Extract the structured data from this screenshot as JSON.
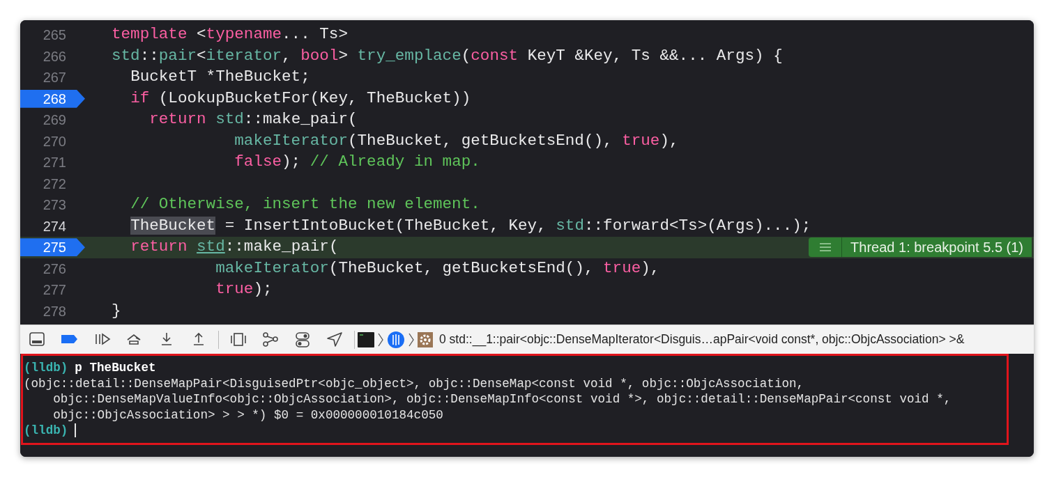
{
  "editor": {
    "lines": [
      {
        "number": "265",
        "breakpoint": false,
        "current": false,
        "focused": false,
        "tokens": [
          {
            "kind": "keyword",
            "text": "template"
          },
          {
            "kind": "plain",
            "text": " <"
          },
          {
            "kind": "keyword",
            "text": "typename"
          },
          {
            "kind": "plain",
            "text": "... Ts>"
          }
        ]
      },
      {
        "number": "266",
        "breakpoint": false,
        "current": false,
        "focused": false,
        "tokens": [
          {
            "kind": "type",
            "text": "std"
          },
          {
            "kind": "plain",
            "text": "::"
          },
          {
            "kind": "type",
            "text": "pair"
          },
          {
            "kind": "plain",
            "text": "<"
          },
          {
            "kind": "type",
            "text": "iterator"
          },
          {
            "kind": "plain",
            "text": ", "
          },
          {
            "kind": "keyword",
            "text": "bool"
          },
          {
            "kind": "plain",
            "text": "> "
          },
          {
            "kind": "type",
            "text": "try_emplace"
          },
          {
            "kind": "plain",
            "text": "("
          },
          {
            "kind": "keyword",
            "text": "const"
          },
          {
            "kind": "plain",
            "text": " KeyT &Key, Ts &&... Args) {"
          }
        ]
      },
      {
        "number": "267",
        "breakpoint": false,
        "current": false,
        "focused": false,
        "tokens": [
          {
            "kind": "plain",
            "text": "  BucketT *TheBucket;"
          }
        ]
      },
      {
        "number": "268",
        "breakpoint": true,
        "current": false,
        "focused": false,
        "tokens": [
          {
            "kind": "keyword",
            "text": "  if"
          },
          {
            "kind": "plain",
            "text": " (LookupBucketFor(Key, TheBucket))"
          }
        ]
      },
      {
        "number": "269",
        "breakpoint": false,
        "current": false,
        "focused": false,
        "tokens": [
          {
            "kind": "keyword",
            "text": "    return "
          },
          {
            "kind": "type",
            "text": "std"
          },
          {
            "kind": "plain",
            "text": "::make_pair("
          }
        ]
      },
      {
        "number": "270",
        "breakpoint": false,
        "current": false,
        "focused": false,
        "tokens": [
          {
            "kind": "type",
            "text": "             makeIterator"
          },
          {
            "kind": "plain",
            "text": "(TheBucket, getBucketsEnd(), "
          },
          {
            "kind": "keyword",
            "text": "true"
          },
          {
            "kind": "plain",
            "text": "),"
          }
        ]
      },
      {
        "number": "271",
        "breakpoint": false,
        "current": false,
        "focused": false,
        "tokens": [
          {
            "kind": "keyword",
            "text": "             false"
          },
          {
            "kind": "plain",
            "text": "); "
          },
          {
            "kind": "comment",
            "text": "// Already in map."
          }
        ]
      },
      {
        "number": "272",
        "breakpoint": false,
        "current": false,
        "focused": false
      },
      {
        "number": "273",
        "breakpoint": false,
        "current": false,
        "focused": false,
        "tokens": [
          {
            "kind": "comment",
            "text": "  // Otherwise, insert the new element."
          }
        ]
      },
      {
        "number": "274",
        "breakpoint": false,
        "current": false,
        "focused": true,
        "tokens": [
          {
            "kind": "selection",
            "text": "  TheBucket"
          },
          {
            "kind": "plain",
            "text": " = InsertIntoBucket(TheBucket, Key, "
          },
          {
            "kind": "type",
            "text": "std"
          },
          {
            "kind": "plain",
            "text": "::forward<Ts>(Args)...);"
          }
        ]
      },
      {
        "number": "275",
        "breakpoint": true,
        "current": true,
        "focused": false,
        "tokens": [
          {
            "kind": "keyword",
            "text": "  return "
          },
          {
            "kind": "link",
            "text": "std"
          },
          {
            "kind": "plain",
            "text": "::make_pair("
          }
        ]
      },
      {
        "number": "276",
        "breakpoint": false,
        "current": false,
        "focused": false,
        "tokens": [
          {
            "kind": "type",
            "text": "           makeIterator"
          },
          {
            "kind": "plain",
            "text": "(TheBucket, getBucketsEnd(), "
          },
          {
            "kind": "keyword",
            "text": "true"
          },
          {
            "kind": "plain",
            "text": "),"
          }
        ]
      },
      {
        "number": "277",
        "breakpoint": false,
        "current": false,
        "focused": false,
        "tokens": [
          {
            "kind": "keyword",
            "text": "           true"
          },
          {
            "kind": "plain",
            "text": ");"
          }
        ]
      },
      {
        "number": "278",
        "breakpoint": false,
        "current": false,
        "focused": false,
        "tokens": [
          {
            "kind": "plain",
            "text": "}"
          }
        ]
      }
    ],
    "badge": {
      "text": "Thread 1: breakpoint 5.5 (1)"
    }
  },
  "toolbar": {
    "buttons": [
      {
        "kind": "console",
        "on": false
      },
      {
        "kind": "breakpoints",
        "on": true
      },
      {
        "kind": "continue",
        "on": false
      },
      {
        "kind": "step-over",
        "on": false
      },
      {
        "kind": "step-into",
        "on": false
      },
      {
        "kind": "step-out",
        "on": false
      },
      {
        "kind": "divider"
      },
      {
        "kind": "view-debugger",
        "on": false
      },
      {
        "kind": "memory-graph",
        "on": false
      },
      {
        "kind": "environment",
        "on": false
      },
      {
        "kind": "location",
        "on": false
      },
      {
        "kind": "divider"
      }
    ],
    "frame": "0 std::__1::pair<objc::DenseMapIterator<Disguis…apPair<void const*, objc::ObjcAssociation> >&"
  },
  "console": {
    "lines": [
      {
        "kind": "command",
        "prompt": "(lldb)",
        "text": "p TheBucket"
      },
      {
        "kind": "output",
        "text": "(objc::detail::DenseMapPair<DisguisedPtr<objc_object>, objc::DenseMap<const void *, objc::ObjcAssociation,"
      },
      {
        "kind": "output",
        "text": "    objc::DenseMapValueInfo<objc::ObjcAssociation>, objc::DenseMapInfo<const void *>, objc::detail::DenseMapPair<const void *,"
      },
      {
        "kind": "output",
        "text": "    objc::ObjcAssociation> > > *) $0 = 0x000000010184c050"
      },
      {
        "kind": "input",
        "prompt": "(lldb)"
      }
    ]
  }
}
